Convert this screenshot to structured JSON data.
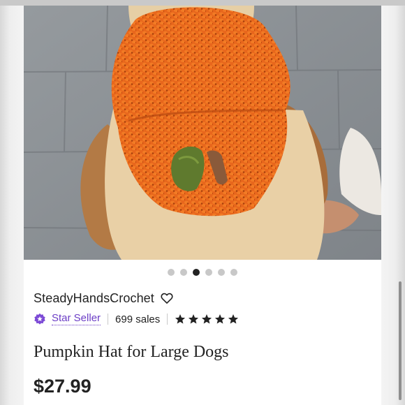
{
  "gallery": {
    "image_description": "",
    "dot_count": 6,
    "active_index": 2
  },
  "shop": {
    "name": "SteadyHandsCrochet",
    "badge_label": "Star Seller",
    "sales": "699 sales",
    "rating_stars": 5
  },
  "listing": {
    "title": "Pumpkin Hat for Large Dogs",
    "price": "$27.99"
  },
  "colors": {
    "star_seller": "#6c3ec6",
    "text": "#222222",
    "active_dot": "#222222",
    "inactive_dot": "#c8c8c8"
  },
  "icons": {
    "favorite": "heart-icon",
    "badge": "star-seller-badge-icon",
    "rating": "star-icon"
  }
}
